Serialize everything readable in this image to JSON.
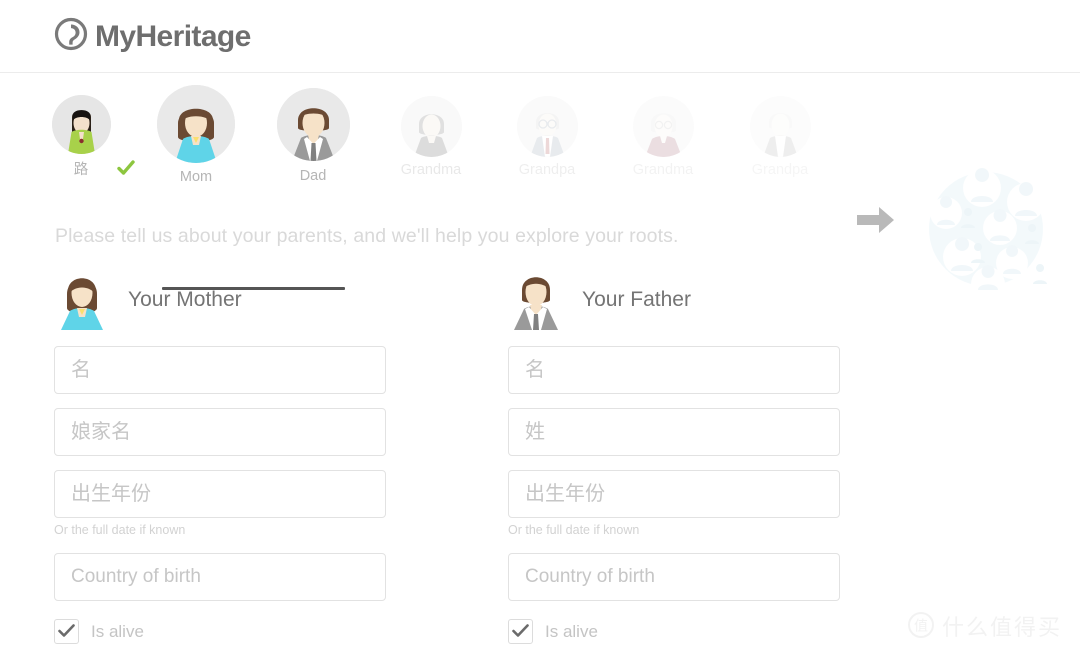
{
  "header": {
    "brand_name": "MyHeritage",
    "logo_icon": "myheritage-logo-icon",
    "logo_color": "#6e6e6e"
  },
  "avatar_strip": {
    "items": [
      {
        "label": "路",
        "state": "completed",
        "badge_icon": "green-check-icon"
      },
      {
        "label": "Mom",
        "state": "active"
      },
      {
        "label": "Dad",
        "state": "active"
      },
      {
        "label": "Grandma",
        "state": "dimmed"
      },
      {
        "label": "Grandpa",
        "state": "dimmed"
      },
      {
        "label": "Grandma",
        "state": "dimmed"
      },
      {
        "label": "Grandpa",
        "state": "dimmed"
      }
    ],
    "arrow_icon": "arrow-right-icon",
    "tree_icon": "family-tree-cluster-icon",
    "active_underline_color": "#555555",
    "check_color": "#8dc63f"
  },
  "instruction": "Please tell us about your parents, and we'll help you explore your roots.",
  "mother": {
    "title": "Your Mother",
    "avatar_icon": "mother-avatar-icon",
    "fields": [
      {
        "name": "first-name",
        "placeholder": "名",
        "value": "",
        "cjk": true
      },
      {
        "name": "maiden-name",
        "placeholder": "娘家名",
        "value": "",
        "cjk": true
      },
      {
        "name": "birth-year",
        "placeholder": "出生年份",
        "value": "",
        "cjk": true
      },
      {
        "name": "country-of-birth",
        "placeholder": "Country of birth",
        "value": "",
        "cjk": false
      }
    ],
    "helper_text": "Or the full date if known",
    "is_alive_label": "Is alive",
    "is_alive_checked": true
  },
  "father": {
    "title": "Your Father",
    "avatar_icon": "father-avatar-icon",
    "fields": [
      {
        "name": "first-name",
        "placeholder": "名",
        "value": "",
        "cjk": true
      },
      {
        "name": "last-name",
        "placeholder": "姓",
        "value": "",
        "cjk": true
      },
      {
        "name": "birth-year",
        "placeholder": "出生年份",
        "value": "",
        "cjk": true
      },
      {
        "name": "country-of-birth",
        "placeholder": "Country of birth",
        "value": "",
        "cjk": false
      }
    ],
    "helper_text": "Or the full date if known",
    "is_alive_label": "Is alive",
    "is_alive_checked": true
  },
  "watermark": {
    "logo_char": "值",
    "text": "什么值得买"
  }
}
